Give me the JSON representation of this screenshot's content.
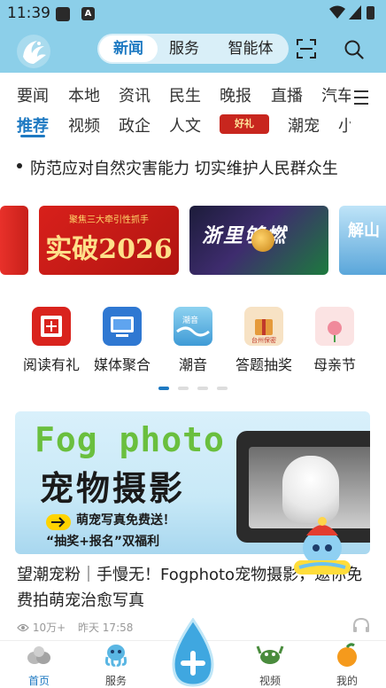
{
  "status_bar": {
    "time": "11:39",
    "notification_letter": "A"
  },
  "top_tabs": [
    {
      "label": "新闻",
      "active": true
    },
    {
      "label": "服务",
      "active": false
    },
    {
      "label": "智能体",
      "active": false
    }
  ],
  "categories_row1": [
    "要闻",
    "本地",
    "资讯",
    "民生",
    "晚报",
    "直播",
    "汽车"
  ],
  "categories_row2": [
    "推荐",
    "视频",
    "政企",
    "人文",
    "潮宠",
    "小"
  ],
  "gift_pill": "好礼",
  "ticker": {
    "text": "防范应对自然灾害能力  切实维护人民群众生"
  },
  "banners": {
    "b2_small": "聚焦三大牵引性抓手",
    "b2_big": "实破2026",
    "b3_big": "浙里够燃",
    "b4_big": "解山"
  },
  "services": [
    {
      "label": "阅读有礼",
      "icon": "red-book-icon"
    },
    {
      "label": "媒体聚合",
      "icon": "media-tv-icon"
    },
    {
      "label": "潮音",
      "icon": "wave-icon"
    },
    {
      "label": "答题抽奖",
      "icon": "quiz-gift-icon"
    },
    {
      "label": "母亲节",
      "icon": "mothers-day-icon"
    }
  ],
  "article": {
    "image_title_en": "Fog photo",
    "image_title_cn": "宠物摄影",
    "promo_line1": "萌宠写真免费送！",
    "promo_line2": "“抽奖+报名”双福利",
    "headline": "望潮宠粉｜手慢无！Fogphoto宠物摄影，邀你免费拍萌宠治愈写真",
    "views": "10万+",
    "time": "昨天  17:58"
  },
  "bottom_nav": [
    {
      "label": "首页",
      "icon": "home-eggs-icon",
      "active": true
    },
    {
      "label": "服务",
      "icon": "octopus-icon",
      "active": false
    },
    {
      "label": "视频",
      "icon": "crab-icon",
      "active": false
    },
    {
      "label": "我的",
      "icon": "orange-icon",
      "active": false
    }
  ],
  "colors": {
    "accent": "#1d79c2",
    "header_bg": "#8ccfe9"
  }
}
